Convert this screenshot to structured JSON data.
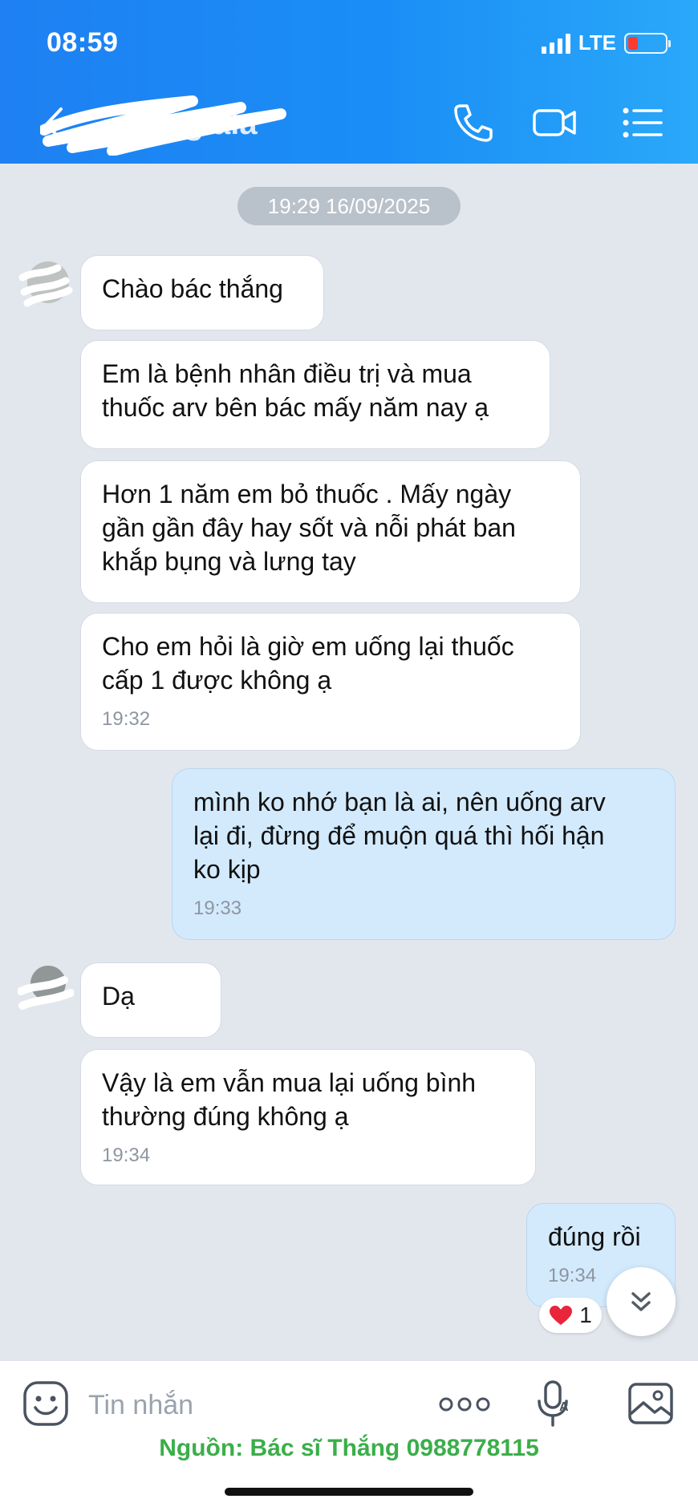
{
  "status_bar": {
    "time": "08:59",
    "network": "LTE"
  },
  "header": {
    "contact_name": "giala"
  },
  "chat": {
    "date_separator": "19:29 16/09/2025",
    "messages": [
      {
        "direction": "in",
        "text": "Chào bác thắng",
        "time": ""
      },
      {
        "direction": "in",
        "text": "Em là bệnh nhân điều trị và mua\nthuốc arv bên bác mấy năm nay ạ",
        "time": ""
      },
      {
        "direction": "in",
        "text": "Hơn 1 năm em bỏ thuốc . Mấy ngày\ngần gần đây hay sốt và nỗi phát ban\nkhắp bụng và lưng tay",
        "time": ""
      },
      {
        "direction": "in",
        "text": "Cho em hỏi là giờ em uống lại thuốc\ncấp 1 được không ạ",
        "time": "19:32"
      },
      {
        "direction": "out",
        "text": "mình ko nhớ bạn là ai, nên uống arv\nlại đi, đừng để muộn quá thì hối hận\nko kịp",
        "time": "19:33"
      },
      {
        "direction": "in",
        "text": "Dạ",
        "time": ""
      },
      {
        "direction": "in",
        "text": "Vậy là em vẫn mua lại uống bình\nthường đúng không ạ",
        "time": "19:34"
      },
      {
        "direction": "out",
        "text": "đúng rồi",
        "time": "19:34"
      }
    ],
    "reaction": {
      "emoji": "❤️",
      "count": "1"
    }
  },
  "input": {
    "placeholder": "Tin nhắn"
  },
  "footer": {
    "source_text": "Nguồn: Bác sĩ Thắng 0988778115"
  },
  "colors": {
    "header_blue": "#1e80f2",
    "outgoing_bubble": "#d3eafd",
    "chat_bg": "#e2e7ee",
    "source_green": "#3bae4a"
  }
}
